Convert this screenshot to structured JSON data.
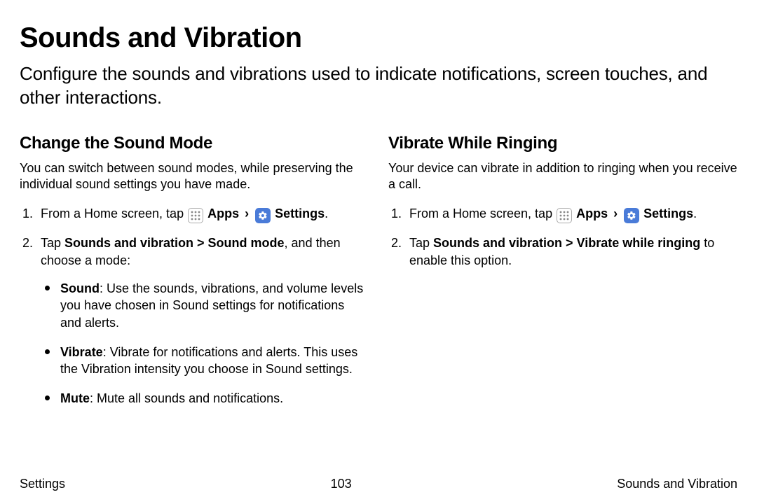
{
  "title": "Sounds and Vibration",
  "subtitle": "Configure the sounds and vibrations used to indicate notifications, screen touches, and other interactions.",
  "left": {
    "heading": "Change the Sound Mode",
    "intro": "You can switch between sound modes, while preserving the individual sound settings you have made.",
    "step1_pre": "From a Home screen, tap ",
    "apps_label": "Apps",
    "settings_label": "Settings",
    "period": ".",
    "step2_pre": "Tap ",
    "step2_bold": "Sounds and vibration > Sound mode",
    "step2_post": ", and then choose a mode:",
    "opt1_name": "Sound",
    "opt1_desc": ": Use the sounds, vibrations, and volume levels you have chosen in Sound settings for notifications and alerts.",
    "opt2_name": "Vibrate",
    "opt2_desc": ": Vibrate for notifications and alerts. This uses the Vibration intensity you choose in Sound settings.",
    "opt3_name": "Mute",
    "opt3_desc": ": Mute all sounds and notifications."
  },
  "right": {
    "heading": "Vibrate While Ringing",
    "intro": "Your device can vibrate in addition to ringing when you receive a call.",
    "step1_pre": "From a Home screen, tap ",
    "apps_label": "Apps",
    "settings_label": "Settings",
    "period": ".",
    "step2_pre": "Tap ",
    "step2_bold": "Sounds and vibration > Vibrate while ringing",
    "step2_post": " to enable this option."
  },
  "footer": {
    "left": "Settings",
    "center": "103",
    "right": "Sounds and Vibration"
  }
}
